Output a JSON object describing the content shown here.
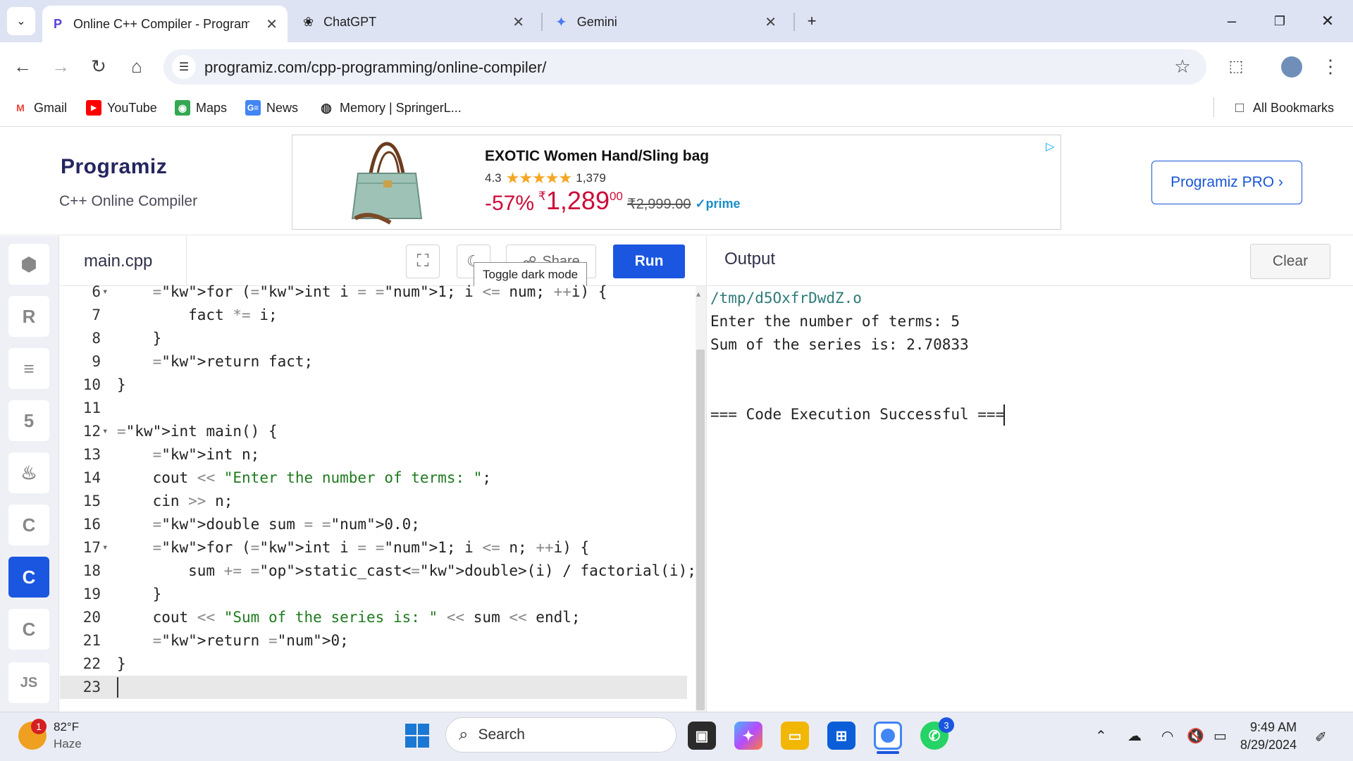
{
  "browser": {
    "tabs": [
      {
        "label": "Online C++ Compiler - Program",
        "active": true
      },
      {
        "label": "ChatGPT",
        "active": false
      },
      {
        "label": "Gemini",
        "active": false
      }
    ],
    "url": "programiz.com/cpp-programming/online-compiler/",
    "bookmarks": [
      "Gmail",
      "YouTube",
      "Maps",
      "News",
      "Memory | SpringerL...",
      "All Bookmarks"
    ]
  },
  "site": {
    "logo": "Programiz",
    "subtitle": "C++ Online Compiler",
    "pro_button": "Programiz PRO ›",
    "ad": {
      "title": "EXOTIC Women Hand/Sling bag",
      "rating": "4.3",
      "reviews": "1,379",
      "stars": "★★★★★",
      "discount": "-57%",
      "currency": "₹",
      "price": "1,289",
      "price_fraction": "00",
      "mrp": "₹2,999.00",
      "prime": "✓prime"
    }
  },
  "sidebar": {
    "languages": [
      "python",
      "r",
      "sql",
      "html",
      "java",
      "c",
      "cpp",
      "csharp",
      "JS"
    ]
  },
  "editor": {
    "filename": "main.cpp",
    "share_label": "Share",
    "run_label": "Run",
    "tooltip": "Toggle dark mode",
    "lines": [
      {
        "n": "6",
        "fold": true
      },
      {
        "n": "7",
        "fold": false
      },
      {
        "n": "8",
        "fold": false
      },
      {
        "n": "9",
        "fold": false
      },
      {
        "n": "10",
        "fold": false
      },
      {
        "n": "11",
        "fold": false
      },
      {
        "n": "12",
        "fold": true
      },
      {
        "n": "13",
        "fold": false
      },
      {
        "n": "14",
        "fold": false
      },
      {
        "n": "15",
        "fold": false
      },
      {
        "n": "16",
        "fold": false
      },
      {
        "n": "17",
        "fold": true
      },
      {
        "n": "18",
        "fold": false
      },
      {
        "n": "19",
        "fold": false
      },
      {
        "n": "20",
        "fold": false
      },
      {
        "n": "21",
        "fold": false
      },
      {
        "n": "22",
        "fold": false
      },
      {
        "n": "23",
        "fold": false
      }
    ],
    "code": [
      "    for (int i = 1; i <= num; ++i) {",
      "        fact *= i;",
      "    }",
      "    return fact;",
      "}",
      "",
      "int main() {",
      "    int n;",
      "    cout << \"Enter the number of terms: \";",
      "    cin >> n;",
      "    double sum = 0.0;",
      "    for (int i = 1; i <= n; ++i) {",
      "        sum += static_cast<double>(i) / factorial(i);",
      "    }",
      "    cout << \"Sum of the series is: \" << sum << endl;",
      "    return 0;",
      "}",
      ""
    ]
  },
  "output": {
    "title": "Output",
    "clear_label": "Clear",
    "lines": [
      "/tmp/d5OxfrDwdZ.o",
      "Enter the number of terms: 5",
      "Sum of the series is: 2.70833",
      "",
      "",
      "=== Code Execution Successful ==="
    ]
  },
  "taskbar": {
    "temperature": "82°F",
    "weather": "Haze",
    "weather_badge": "1",
    "search_placeholder": "Search",
    "whatsapp_badge": "3",
    "time": "9:49 AM",
    "date": "8/29/2024"
  },
  "colors": {
    "accent": "#1a56e0",
    "keyword": "#1a56d6",
    "string": "#1f7a1f",
    "sale": "#cc0c39"
  }
}
